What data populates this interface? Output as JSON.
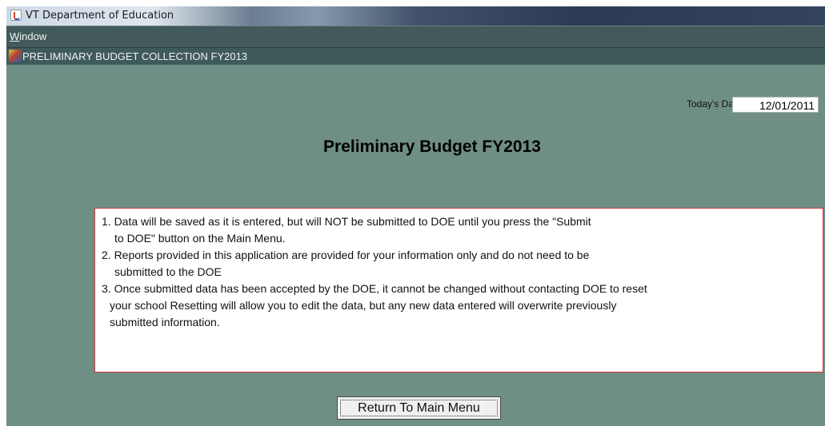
{
  "window": {
    "title": "VT Department of Education"
  },
  "menubar": {
    "items": [
      {
        "label": "Window",
        "mnemonic": "W",
        "rest": "indow"
      }
    ]
  },
  "internal_frame": {
    "title": "PRELIMINARY BUDGET COLLECTION FY2013"
  },
  "date": {
    "label": "Today's Date",
    "value": "12/01/2011"
  },
  "heading": "Preliminary Budget FY2013",
  "notice": {
    "lines": [
      "1. Data will be saved as it is entered, but will NOT be submitted to DOE until you press the \"Submit",
      "to DOE\" button on the Main Menu.",
      "2. Reports provided in this application are provided for your information only and do not need to be",
      "submitted to the DOE",
      "3. Once submitted data has been accepted by the DOE, it cannot be changed without contacting DOE to reset",
      "your school  Resetting will allow you to edit the data, but any new data entered will overwrite previously",
      "submitted information."
    ]
  },
  "buttons": {
    "return_label": "Return To Main Menu"
  },
  "colors": {
    "panel_background": "#6f8e86",
    "menubar": "#425a5b",
    "notice_border": "#d13b3b"
  }
}
